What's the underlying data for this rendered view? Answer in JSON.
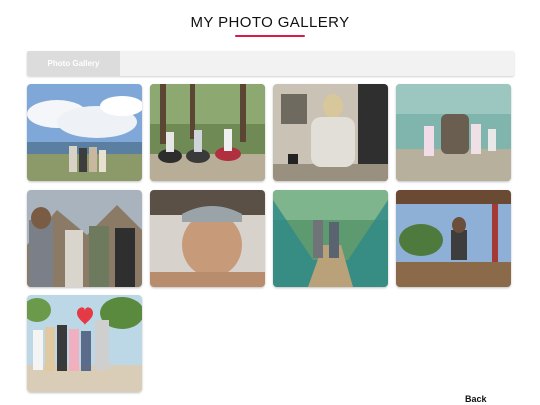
{
  "page": {
    "title": "MY PHOTO GALLERY",
    "accent_color": "#d81b4a"
  },
  "tabs": [
    {
      "label": "Photo Gallery",
      "active": true
    }
  ],
  "gallery": {
    "photos": [
      {
        "subject": "seaside group under cloudy sky"
      },
      {
        "subject": "motorbikes on dirt road"
      },
      {
        "subject": "person in hoodie indoors"
      },
      {
        "subject": "children by stone statue"
      },
      {
        "subject": "group with mountains"
      },
      {
        "subject": "selfie with cap"
      },
      {
        "subject": "couple on hanging bridge"
      },
      {
        "subject": "person seated under shelter"
      },
      {
        "subject": "group photo at beach with heart emoji"
      }
    ]
  },
  "footer": {
    "back_label": "Back"
  }
}
